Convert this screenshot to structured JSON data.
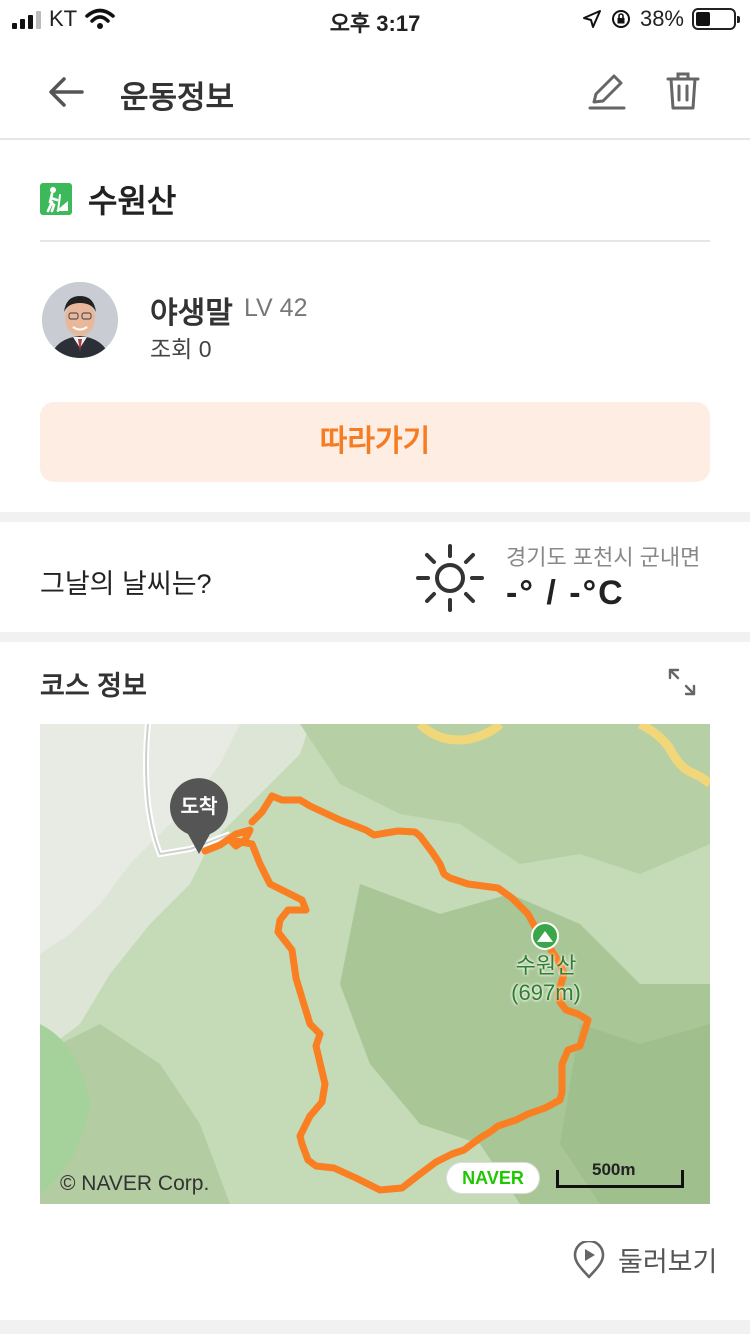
{
  "status_bar": {
    "carrier": "KT",
    "time": "오후 3:17",
    "battery_percent": "38%",
    "battery_level": 0.38
  },
  "app_bar": {
    "title": "운동정보",
    "back_icon": "arrow-left-icon",
    "edit_icon": "pencil-icon",
    "delete_icon": "trash-icon"
  },
  "activity": {
    "mountain_name": "수원산",
    "activity_icon": "hiking-icon",
    "user": {
      "name": "야생말",
      "level": "LV 42",
      "views": "조회 0"
    },
    "follow_label": "따라가기"
  },
  "weather": {
    "question": "그날의 날씨는?",
    "location": "경기도 포천시 군내면",
    "temperature": "-° / -°C",
    "icon": "sun-icon"
  },
  "course": {
    "title": "코스 정보",
    "expand_icon": "expand-icon",
    "map": {
      "destination_label": "도착",
      "peak_name": "수원산",
      "peak_elevation": "(697m)",
      "provider_badge": "NAVER",
      "copyright": "© NAVER Corp.",
      "scale_label": "500m",
      "route_color": "#f97f22"
    },
    "look_around_label": "둘러보기",
    "look_around_icon": "play-pin-icon"
  },
  "colors": {
    "accent": "#f57c22",
    "accent_bg": "#fdede3",
    "naver_green": "#1ec800",
    "hike_green": "#3cb95a"
  }
}
